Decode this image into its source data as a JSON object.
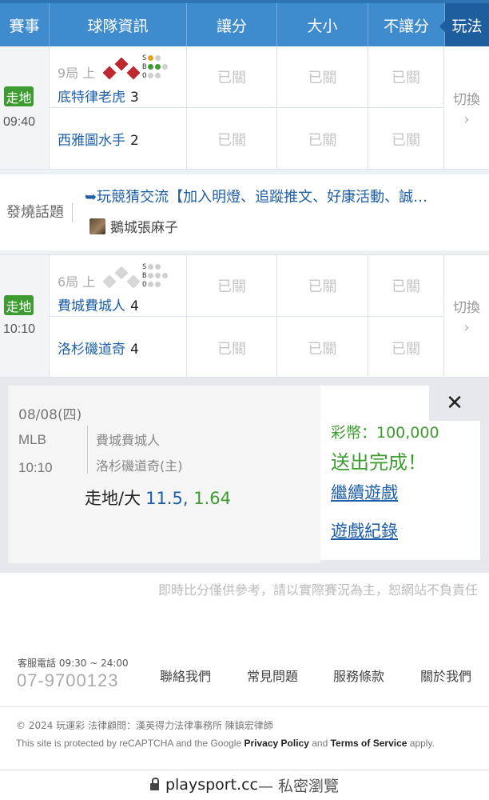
{
  "header": {
    "event": "賽事",
    "team_info": "球隊資訊",
    "spread": "讓分",
    "over_under": "大小",
    "moneyline": "不讓分",
    "play": "玩法"
  },
  "games": [
    {
      "status": "走地",
      "time": "09:40",
      "inning": "9局 上",
      "away": {
        "name": "底特律老虎",
        "score": "3"
      },
      "home": {
        "name": "西雅圖水手",
        "score": "2"
      },
      "closed_label": "已關",
      "switch_label": "切換",
      "bases": {
        "first": true,
        "second": true,
        "third": false
      },
      "sbo": {
        "s": 1,
        "b": 2,
        "o": 0
      }
    },
    {
      "status": "走地",
      "time": "10:10",
      "inning": "6局 上",
      "away": {
        "name": "費城費城人",
        "score": "4"
      },
      "home": {
        "name": "洛杉磯道奇",
        "score": "4"
      },
      "closed_label": "已關",
      "switch_label": "切換",
      "bases": {
        "first": false,
        "second": false,
        "third": false
      },
      "sbo": {
        "s": 0,
        "b": 0,
        "o": 0
      }
    }
  ],
  "hot_topic": {
    "label": "發燒話題",
    "title": "➥玩競猜交流【加入明燈、追蹤推文、好康活動、誠…",
    "author": "鵝城張麻子"
  },
  "bet_ticket": {
    "date": "08/08(四)",
    "league": "MLB",
    "time": "10:10",
    "away_team": "費城費城人",
    "home_team": "洛杉磯道奇(主)",
    "pick": "走地/大",
    "line": "11.5,",
    "odds": "1.64"
  },
  "bet_result": {
    "coins": "彩幣：100,000",
    "status": "送出完成！",
    "continue_link": "繼續遊戲",
    "history_link": "遊戲紀錄",
    "close": "✕"
  },
  "disclaimer": "即時比分僅供參考，請以實際賽況為主，恕網站不負責任",
  "footer": {
    "service_label": "客服電話 09:30 ~ 24:00",
    "phone": "07-9700123",
    "links": [
      "聯絡我們",
      "常見問題",
      "服務條款",
      "關於我們"
    ],
    "copyright": "© 2024 玩運彩 法律顧問：漢英得力法律事務所 陳鎮宏律師",
    "recaptcha_pre": "This site is protected by reCAPTCHA and the Google",
    "privacy": "Privacy Policy",
    "and": "and",
    "terms": "Terms of Service",
    "apply": "apply."
  },
  "browser": {
    "domain": "playsport.cc",
    "mode": " — 私密瀏覽"
  },
  "colors": {
    "header_blue": "#3e8bcd",
    "live_green": "#3c9c2f",
    "link_blue": "#1d5ea6",
    "runner_red": "#c0282f"
  }
}
